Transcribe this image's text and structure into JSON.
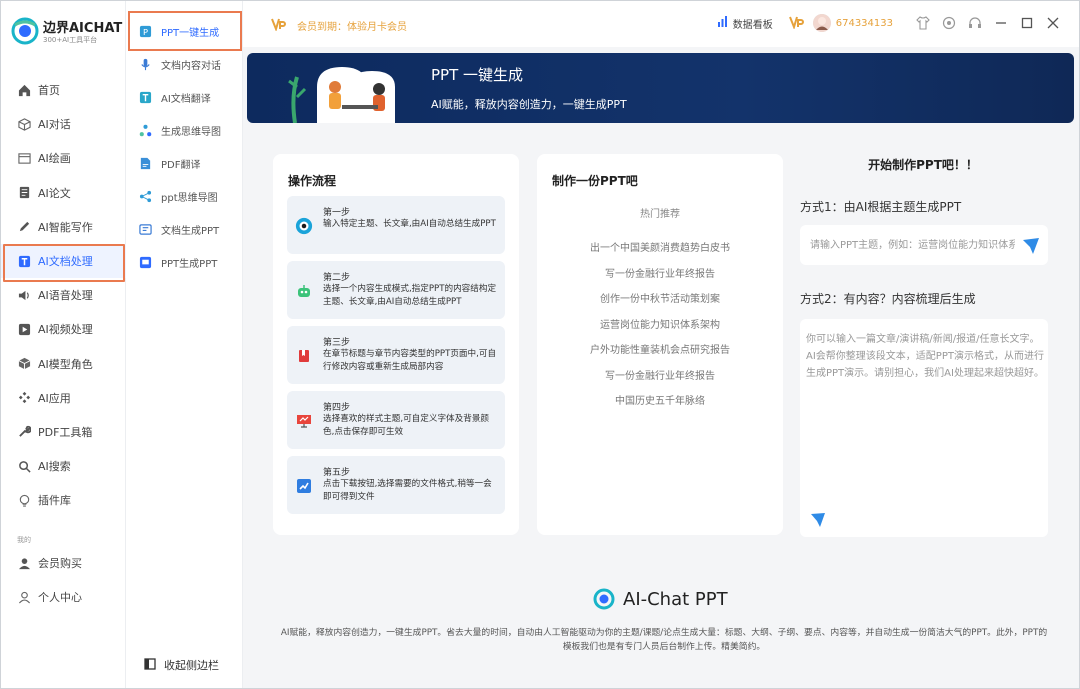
{
  "app": {
    "name": "边界AICHAT",
    "tagline": "300+AI工具平台"
  },
  "sidebar": {
    "items": [
      {
        "label": "首页",
        "icon": "home-icon"
      },
      {
        "label": "AI对话",
        "icon": "cube-icon"
      },
      {
        "label": "AI绘画",
        "icon": "image-icon"
      },
      {
        "label": "AI论文",
        "icon": "document-icon"
      },
      {
        "label": "AI智能写作",
        "icon": "pen-icon"
      },
      {
        "label": "AI文档处理",
        "icon": "text-icon",
        "active": true
      },
      {
        "label": "AI语音处理",
        "icon": "speaker-icon"
      },
      {
        "label": "AI视频处理",
        "icon": "play-icon"
      },
      {
        "label": "AI模型角色",
        "icon": "box-icon"
      },
      {
        "label": "AI应用",
        "icon": "apps-icon"
      },
      {
        "label": "PDF工具箱",
        "icon": "wrench-icon"
      },
      {
        "label": "AI搜索",
        "icon": "search-icon"
      },
      {
        "label": "插件库",
        "icon": "bulb-icon"
      }
    ],
    "section_label": "我的",
    "mine": [
      {
        "label": "会员购买",
        "icon": "user-icon"
      },
      {
        "label": "个人中心",
        "icon": "person-outline-icon"
      }
    ]
  },
  "submenu": {
    "items": [
      {
        "label": "PPT一键生成",
        "active": true
      },
      {
        "label": "文档内容对话"
      },
      {
        "label": "AI文档翻译"
      },
      {
        "label": "生成思维导图"
      },
      {
        "label": "PDF翻译"
      },
      {
        "label": "ppt思维导图"
      },
      {
        "label": "文档生成PPT"
      },
      {
        "label": "PPT生成PPT"
      }
    ],
    "collapse_label": "收起侧边栏"
  },
  "topbar": {
    "membership": "会员到期：体验月卡会员",
    "dashboard": "数据看板",
    "user_id": "674334133"
  },
  "banner": {
    "title": "PPT 一键生成",
    "subtitle": "AI赋能，释放内容创造力，一键生成PPT"
  },
  "steps_card": {
    "title": "操作流程",
    "steps": [
      {
        "title": "第一步",
        "desc": "输入特定主题、长文章,由AI自动总结生成PPT"
      },
      {
        "title": "第二步",
        "desc": "选择一个内容生成模式,指定PPT的内容结构定主题、长文章,由AI自动总结生成PPT"
      },
      {
        "title": "第三步",
        "desc": "在章节标题与章节内容类型的PPT页面中,可自行修改内容或重新生成局部内容"
      },
      {
        "title": "第四步",
        "desc": "选择喜欢的样式主题,可自定义字体及背景颜色,点击保存即可生效"
      },
      {
        "title": "第五步",
        "desc": "点击下载按钮,选择需要的文件格式,稍等一会即可得到文件"
      }
    ]
  },
  "hot_card": {
    "title": "制作一份PPT吧",
    "subtitle": "热门推荐",
    "items": [
      "出一个中国美颜消费趋势白皮书",
      "写一份金融行业年终报告",
      "创作一份中秋节活动策划案",
      "运营岗位能力知识体系架构",
      "户外功能性童装机会点研究报告",
      "写一份金融行业年终报告",
      "中国历史五千年脉络"
    ]
  },
  "create_panel": {
    "title": "开始制作PPT吧！！",
    "method1": "方式1：由AI根据主题生成PPT",
    "topic_placeholder": "请输入PPT主题，例如：运营岗位能力知识体系架构",
    "method2": "方式2：有内容？内容梳理后生成",
    "content_placeholder": "你可以输入一篇文章/演讲稿/新闻/报道/任意长文字。AI会帮你整理该段文本，适配PPT演示格式，从而进行生成PPT演示。请别担心，我们AI处理起来超快超好。"
  },
  "footer": {
    "brand": "AI-Chat PPT",
    "description": "AI赋能，释放内容创造力，一键生成PPT。省去大量的时间，自动由人工智能驱动为你的主题/课题/论点生成大量：标题、大纲、子纲、要点、内容等，并自动生成一份简洁大气的PPT。此外，PPT的模板我们也是有专门人员后台制作上传。精美简约。"
  },
  "colors": {
    "accent": "#2f6bff",
    "highlight": "#ea7a4f",
    "banner": "#0d2a5e",
    "vip": "#e6a23c"
  }
}
